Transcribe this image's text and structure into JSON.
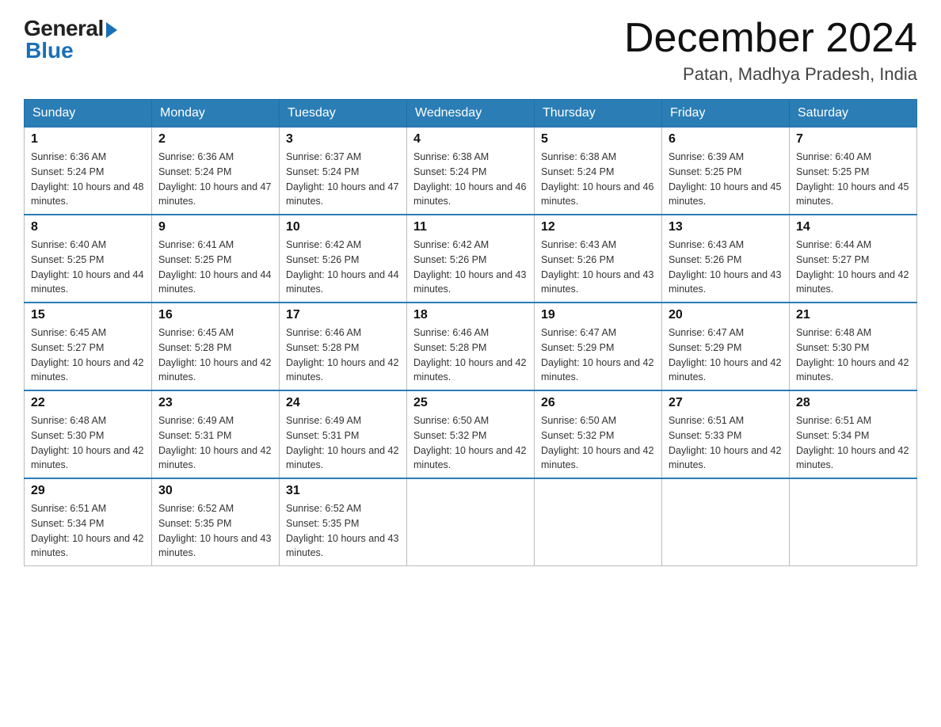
{
  "header": {
    "logo_general": "General",
    "logo_blue": "Blue",
    "month_title": "December 2024",
    "location": "Patan, Madhya Pradesh, India"
  },
  "weekdays": [
    "Sunday",
    "Monday",
    "Tuesday",
    "Wednesday",
    "Thursday",
    "Friday",
    "Saturday"
  ],
  "weeks": [
    [
      {
        "day": "1",
        "sunrise": "6:36 AM",
        "sunset": "5:24 PM",
        "daylight": "10 hours and 48 minutes."
      },
      {
        "day": "2",
        "sunrise": "6:36 AM",
        "sunset": "5:24 PM",
        "daylight": "10 hours and 47 minutes."
      },
      {
        "day": "3",
        "sunrise": "6:37 AM",
        "sunset": "5:24 PM",
        "daylight": "10 hours and 47 minutes."
      },
      {
        "day": "4",
        "sunrise": "6:38 AM",
        "sunset": "5:24 PM",
        "daylight": "10 hours and 46 minutes."
      },
      {
        "day": "5",
        "sunrise": "6:38 AM",
        "sunset": "5:24 PM",
        "daylight": "10 hours and 46 minutes."
      },
      {
        "day": "6",
        "sunrise": "6:39 AM",
        "sunset": "5:25 PM",
        "daylight": "10 hours and 45 minutes."
      },
      {
        "day": "7",
        "sunrise": "6:40 AM",
        "sunset": "5:25 PM",
        "daylight": "10 hours and 45 minutes."
      }
    ],
    [
      {
        "day": "8",
        "sunrise": "6:40 AM",
        "sunset": "5:25 PM",
        "daylight": "10 hours and 44 minutes."
      },
      {
        "day": "9",
        "sunrise": "6:41 AM",
        "sunset": "5:25 PM",
        "daylight": "10 hours and 44 minutes."
      },
      {
        "day": "10",
        "sunrise": "6:42 AM",
        "sunset": "5:26 PM",
        "daylight": "10 hours and 44 minutes."
      },
      {
        "day": "11",
        "sunrise": "6:42 AM",
        "sunset": "5:26 PM",
        "daylight": "10 hours and 43 minutes."
      },
      {
        "day": "12",
        "sunrise": "6:43 AM",
        "sunset": "5:26 PM",
        "daylight": "10 hours and 43 minutes."
      },
      {
        "day": "13",
        "sunrise": "6:43 AM",
        "sunset": "5:26 PM",
        "daylight": "10 hours and 43 minutes."
      },
      {
        "day": "14",
        "sunrise": "6:44 AM",
        "sunset": "5:27 PM",
        "daylight": "10 hours and 42 minutes."
      }
    ],
    [
      {
        "day": "15",
        "sunrise": "6:45 AM",
        "sunset": "5:27 PM",
        "daylight": "10 hours and 42 minutes."
      },
      {
        "day": "16",
        "sunrise": "6:45 AM",
        "sunset": "5:28 PM",
        "daylight": "10 hours and 42 minutes."
      },
      {
        "day": "17",
        "sunrise": "6:46 AM",
        "sunset": "5:28 PM",
        "daylight": "10 hours and 42 minutes."
      },
      {
        "day": "18",
        "sunrise": "6:46 AM",
        "sunset": "5:28 PM",
        "daylight": "10 hours and 42 minutes."
      },
      {
        "day": "19",
        "sunrise": "6:47 AM",
        "sunset": "5:29 PM",
        "daylight": "10 hours and 42 minutes."
      },
      {
        "day": "20",
        "sunrise": "6:47 AM",
        "sunset": "5:29 PM",
        "daylight": "10 hours and 42 minutes."
      },
      {
        "day": "21",
        "sunrise": "6:48 AM",
        "sunset": "5:30 PM",
        "daylight": "10 hours and 42 minutes."
      }
    ],
    [
      {
        "day": "22",
        "sunrise": "6:48 AM",
        "sunset": "5:30 PM",
        "daylight": "10 hours and 42 minutes."
      },
      {
        "day": "23",
        "sunrise": "6:49 AM",
        "sunset": "5:31 PM",
        "daylight": "10 hours and 42 minutes."
      },
      {
        "day": "24",
        "sunrise": "6:49 AM",
        "sunset": "5:31 PM",
        "daylight": "10 hours and 42 minutes."
      },
      {
        "day": "25",
        "sunrise": "6:50 AM",
        "sunset": "5:32 PM",
        "daylight": "10 hours and 42 minutes."
      },
      {
        "day": "26",
        "sunrise": "6:50 AM",
        "sunset": "5:32 PM",
        "daylight": "10 hours and 42 minutes."
      },
      {
        "day": "27",
        "sunrise": "6:51 AM",
        "sunset": "5:33 PM",
        "daylight": "10 hours and 42 minutes."
      },
      {
        "day": "28",
        "sunrise": "6:51 AM",
        "sunset": "5:34 PM",
        "daylight": "10 hours and 42 minutes."
      }
    ],
    [
      {
        "day": "29",
        "sunrise": "6:51 AM",
        "sunset": "5:34 PM",
        "daylight": "10 hours and 42 minutes."
      },
      {
        "day": "30",
        "sunrise": "6:52 AM",
        "sunset": "5:35 PM",
        "daylight": "10 hours and 43 minutes."
      },
      {
        "day": "31",
        "sunrise": "6:52 AM",
        "sunset": "5:35 PM",
        "daylight": "10 hours and 43 minutes."
      },
      null,
      null,
      null,
      null
    ]
  ]
}
